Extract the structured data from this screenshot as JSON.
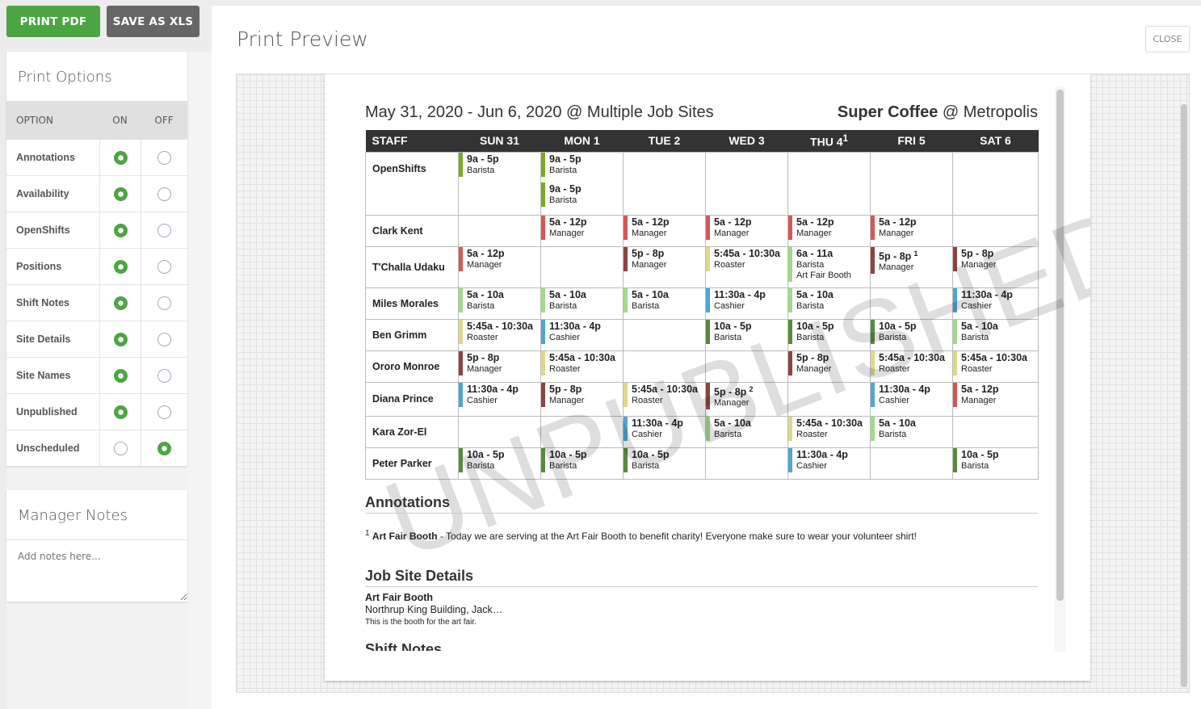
{
  "toolbar": {
    "print_pdf": "PRINT PDF",
    "save_xls": "SAVE AS XLS"
  },
  "print_options": {
    "title": "Print Options",
    "headers": {
      "option": "OPTION",
      "on": "ON",
      "off": "OFF"
    },
    "items": [
      {
        "label": "Annotations",
        "on": true
      },
      {
        "label": "Availability",
        "on": true
      },
      {
        "label": "OpenShifts",
        "on": true
      },
      {
        "label": "Positions",
        "on": true
      },
      {
        "label": "Shift Notes",
        "on": true
      },
      {
        "label": "Site Details",
        "on": true
      },
      {
        "label": "Site Names",
        "on": true
      },
      {
        "label": "Unpublished",
        "on": true
      },
      {
        "label": "Unscheduled",
        "on": false
      }
    ]
  },
  "manager_notes": {
    "title": "Manager Notes",
    "placeholder": "Add notes here..."
  },
  "main": {
    "title": "Print Preview",
    "close": "CLOSE"
  },
  "colors": {
    "open": "#7aab1e",
    "manager": "#d55757",
    "manager_dark": "#8b4343",
    "roaster": "#ddd98a",
    "barista_light": "#a3d98b",
    "cashier": "#4ea6d3",
    "barista_dark": "#5a8a3c",
    "accent": "#4ba543"
  },
  "schedule": {
    "title": "May 31, 2020 - Jun 6, 2020 @ Multiple Job Sites",
    "company_bold": "Super Coffee",
    "company_rest": " @ Metropolis",
    "watermark": "UNPUBLISHED",
    "columns": [
      {
        "label": "STAFF"
      },
      {
        "label": "SUN 31"
      },
      {
        "label": "MON 1"
      },
      {
        "label": "TUE 2"
      },
      {
        "label": "WED 3"
      },
      {
        "label": "THU 4",
        "sup": "1"
      },
      {
        "label": "FRI 5"
      },
      {
        "label": "SAT 6"
      }
    ],
    "rows": [
      {
        "name": "OpenShifts",
        "cells": [
          [
            {
              "time": "9a - 5p",
              "role": "Barista",
              "color": "open"
            }
          ],
          [
            {
              "time": "9a - 5p",
              "role": "Barista",
              "color": "open"
            },
            {
              "time": "9a - 5p",
              "role": "Barista",
              "color": "open"
            }
          ],
          [],
          [],
          [],
          [],
          []
        ]
      },
      {
        "name": "Clark Kent",
        "cells": [
          [],
          [
            {
              "time": "5a - 12p",
              "role": "Manager",
              "color": "manager"
            }
          ],
          [
            {
              "time": "5a - 12p",
              "role": "Manager",
              "color": "manager"
            }
          ],
          [
            {
              "time": "5a - 12p",
              "role": "Manager",
              "color": "manager"
            }
          ],
          [
            {
              "time": "5a - 12p",
              "role": "Manager",
              "color": "manager"
            }
          ],
          [
            {
              "time": "5a - 12p",
              "role": "Manager",
              "color": "manager"
            }
          ],
          []
        ]
      },
      {
        "name": "T'Challa Udaku",
        "cells": [
          [
            {
              "time": "5a - 12p",
              "role": "Manager",
              "color": "manager"
            }
          ],
          [],
          [
            {
              "time": "5p - 8p",
              "role": "Manager",
              "color": "manager_dark"
            }
          ],
          [
            {
              "time": "5:45a - 10:30a",
              "role": "Roaster",
              "color": "roaster"
            }
          ],
          [
            {
              "time": "6a - 11a",
              "role": "Barista",
              "site": "Art Fair Booth",
              "color": "barista_light"
            }
          ],
          [
            {
              "time": "5p - 8p",
              "sup": "1",
              "role": "Manager",
              "color": "manager_dark"
            }
          ],
          [
            {
              "time": "5p - 8p",
              "role": "Manager",
              "color": "manager_dark"
            }
          ]
        ]
      },
      {
        "name": "Miles Morales",
        "cells": [
          [
            {
              "time": "5a - 10a",
              "role": "Barista",
              "color": "barista_light"
            }
          ],
          [
            {
              "time": "5a - 10a",
              "role": "Barista",
              "color": "barista_light"
            }
          ],
          [
            {
              "time": "5a - 10a",
              "role": "Barista",
              "color": "barista_light"
            }
          ],
          [
            {
              "time": "11:30a - 4p",
              "role": "Cashier",
              "color": "cashier"
            }
          ],
          [
            {
              "time": "5a - 10a",
              "role": "Barista",
              "color": "barista_light"
            }
          ],
          [],
          [
            {
              "time": "11:30a - 4p",
              "role": "Cashier",
              "color": "cashier"
            }
          ]
        ]
      },
      {
        "name": "Ben Grimm",
        "cells": [
          [
            {
              "time": "5:45a - 10:30a",
              "role": "Roaster",
              "color": "roaster"
            }
          ],
          [
            {
              "time": "11:30a - 4p",
              "role": "Cashier",
              "color": "cashier"
            }
          ],
          [],
          [
            {
              "time": "10a - 5p",
              "role": "Barista",
              "color": "barista_dark"
            }
          ],
          [
            {
              "time": "10a - 5p",
              "role": "Barista",
              "color": "barista_dark"
            }
          ],
          [
            {
              "time": "10a - 5p",
              "role": "Barista",
              "color": "barista_dark"
            }
          ],
          [
            {
              "time": "5a - 10a",
              "role": "Barista",
              "color": "barista_light"
            }
          ]
        ]
      },
      {
        "name": "Ororo Monroe",
        "cells": [
          [
            {
              "time": "5p - 8p",
              "role": "Manager",
              "color": "manager_dark"
            }
          ],
          [
            {
              "time": "5:45a - 10:30a",
              "role": "Roaster",
              "color": "roaster"
            }
          ],
          [],
          [],
          [
            {
              "time": "5p - 8p",
              "role": "Manager",
              "color": "manager_dark"
            }
          ],
          [
            {
              "time": "5:45a - 10:30a",
              "role": "Roaster",
              "color": "roaster"
            }
          ],
          [
            {
              "time": "5:45a - 10:30a",
              "role": "Roaster",
              "color": "roaster"
            }
          ]
        ]
      },
      {
        "name": "Diana Prince",
        "cells": [
          [
            {
              "time": "11:30a - 4p",
              "role": "Cashier",
              "color": "cashier"
            }
          ],
          [
            {
              "time": "5p - 8p",
              "role": "Manager",
              "color": "manager_dark"
            }
          ],
          [
            {
              "time": "5:45a - 10:30a",
              "role": "Roaster",
              "color": "roaster"
            }
          ],
          [
            {
              "time": "5p - 8p",
              "sup": "2",
              "role": "Manager",
              "color": "manager_dark"
            }
          ],
          [],
          [
            {
              "time": "11:30a - 4p",
              "role": "Cashier",
              "color": "cashier"
            }
          ],
          [
            {
              "time": "5a - 12p",
              "role": "Manager",
              "color": "manager"
            }
          ]
        ]
      },
      {
        "name": "Kara Zor-El",
        "cells": [
          [],
          [],
          [
            {
              "time": "11:30a - 4p",
              "role": "Cashier",
              "color": "cashier"
            }
          ],
          [
            {
              "time": "5a - 10a",
              "role": "Barista",
              "color": "barista_light"
            }
          ],
          [
            {
              "time": "5:45a - 10:30a",
              "role": "Roaster",
              "color": "roaster"
            }
          ],
          [
            {
              "time": "5a - 10a",
              "role": "Barista",
              "color": "barista_light"
            }
          ],
          []
        ]
      },
      {
        "name": "Peter Parker",
        "cells": [
          [
            {
              "time": "10a - 5p",
              "role": "Barista",
              "color": "barista_dark"
            }
          ],
          [
            {
              "time": "10a - 5p",
              "role": "Barista",
              "color": "barista_dark"
            }
          ],
          [
            {
              "time": "10a - 5p",
              "role": "Barista",
              "color": "barista_dark"
            }
          ],
          [],
          [
            {
              "time": "11:30a - 4p",
              "role": "Cashier",
              "color": "cashier"
            }
          ],
          [],
          [
            {
              "time": "10a - 5p",
              "role": "Barista",
              "color": "barista_dark"
            }
          ]
        ]
      }
    ]
  },
  "annotations": {
    "title": "Annotations",
    "items": [
      {
        "num": "1",
        "name": "Art Fair Booth",
        "text": " - Today we are serving at the Art Fair Booth to benefit charity! Everyone make sure to wear your volunteer shirt!"
      }
    ]
  },
  "job_site_details": {
    "title": "Job Site Details",
    "name": "Art Fair Booth",
    "address": "Northrup King Building, Jack…",
    "description": "This is the booth for the art fair."
  },
  "shift_notes": {
    "title": "Shift Notes"
  }
}
